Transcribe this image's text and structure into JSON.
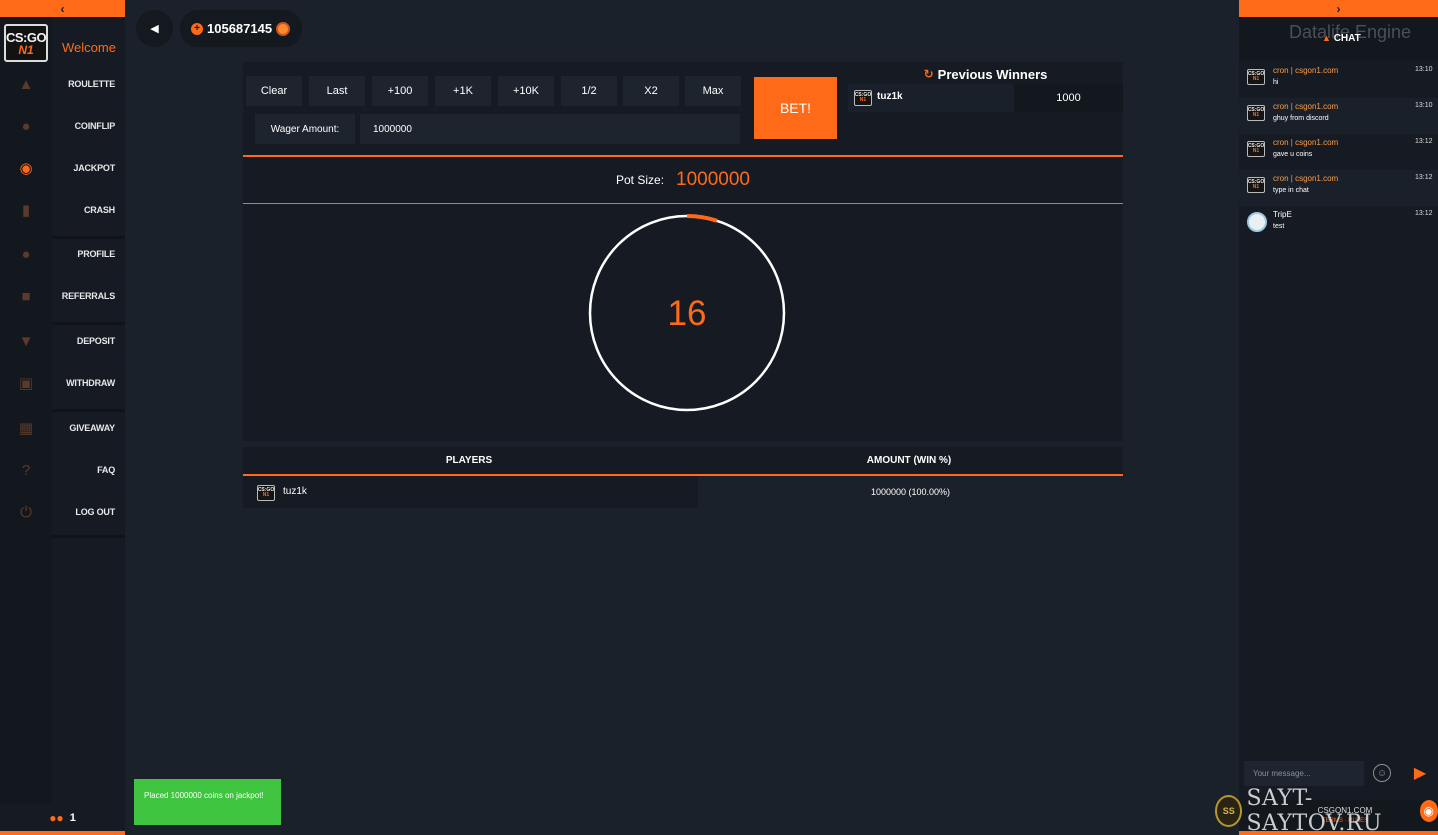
{
  "left_panel": {
    "collapse_arrow": "‹",
    "logo_line1": "CS:GO",
    "logo_line2": "N1",
    "welcome": "Welcome",
    "menu": [
      {
        "label": "ROULETTE",
        "icon": "cowboy-hat-icon"
      },
      {
        "label": "COINFLIP",
        "icon": "coin-icon"
      },
      {
        "label": "JACKPOT",
        "icon": "money-bag-icon"
      },
      {
        "label": "CRASH",
        "icon": "bar-chart-icon"
      },
      {
        "label": "PROFILE",
        "icon": "user-icon"
      },
      {
        "label": "REFERRALS",
        "icon": "group-icon"
      },
      {
        "label": "DEPOSIT",
        "icon": "deposit-icon"
      },
      {
        "label": "WITHDRAW",
        "icon": "cart-icon"
      },
      {
        "label": "GIVEAWAY",
        "icon": "gift-icon"
      },
      {
        "label": "FAQ",
        "icon": "question-icon"
      },
      {
        "label": "LOG OUT",
        "icon": "power-icon"
      }
    ],
    "online_count": "1"
  },
  "header": {
    "balance": "105687145"
  },
  "bet_panel": {
    "quick_buttons": [
      "Clear",
      "Last",
      "+100",
      "+1K",
      "+10K",
      "1/2",
      "X2",
      "Max"
    ],
    "wager_label": "Wager Amount:",
    "wager_value": "1000000",
    "bet_button": "BET!"
  },
  "previous_winners": {
    "title": "Previous Winners",
    "rows": [
      {
        "name": "tuz1k",
        "amount": "1000"
      }
    ]
  },
  "pot": {
    "label": "Pot Size:",
    "value": "1000000",
    "timer": "16",
    "timer_progress": 0.05
  },
  "players_table": {
    "headers": [
      "PLAYERS",
      "AMOUNT (WIN %)"
    ],
    "rows": [
      {
        "name": "tuz1k",
        "amount": "1000000 (100.00%)"
      }
    ]
  },
  "toast": {
    "message": "Placed 1000000 coins on jackpot!"
  },
  "chat": {
    "collapse_arrow": "›",
    "watermark": "Datalife Engine",
    "title": "CHAT",
    "messages": [
      {
        "user": "cron | csgon1.com",
        "text": "hi",
        "time": "13:10"
      },
      {
        "user": "cron | csgon1.com",
        "text": "ghuy from discord",
        "time": "13:10"
      },
      {
        "user": "cron | csgon1.com",
        "text": "gave u coins",
        "time": "13:12"
      },
      {
        "user": "cron | csgon1.com",
        "text": "type in chat",
        "time": "13:12"
      },
      {
        "user": "TripE",
        "text": "test",
        "time": "13:12"
      }
    ],
    "input_placeholder": "Your message...",
    "footer_brand": "CSGON1.COM",
    "footer_sub": "TERMS · RULES"
  },
  "site_watermark": {
    "text": "SAYT-SAYTOV.RU",
    "seal_text": "SS"
  },
  "colors": {
    "accent": "#ff6a18",
    "background": "#1b212b",
    "panel": "#161b23",
    "success": "#3ec43e"
  }
}
